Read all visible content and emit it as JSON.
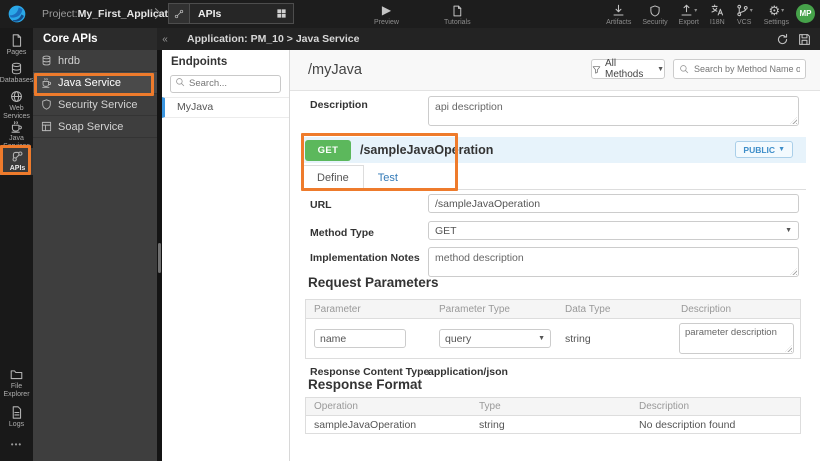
{
  "colors": {
    "annotation_orange": "#ee7b2c",
    "selection_blue": "#3b96e0",
    "get_green": "#5cb85c",
    "link_blue": "#337ab7",
    "avatar_green": "#46a24a"
  },
  "topbar": {
    "project_label": "Project:",
    "project_name": "My_First_Application",
    "apis_tab_label": "APIs",
    "preview_label": "Preview",
    "tutorials_label": "Tutorials",
    "artifacts_label": "Artifacts",
    "security_label": "Security",
    "export_label": "Export",
    "i18n_label": "I18N",
    "vcs_label": "VCS",
    "settings_label": "Settings",
    "avatar_initials": "MP"
  },
  "rail": {
    "items": [
      {
        "label": "Pages"
      },
      {
        "label": "Databases"
      },
      {
        "label": "Web Services"
      },
      {
        "label": "Java Services"
      },
      {
        "label": "APIs"
      },
      {
        "label": "File Explorer"
      },
      {
        "label": "Logs"
      }
    ],
    "more_label": "•••"
  },
  "core_apis": {
    "title": "Core APIs",
    "items": [
      {
        "label": "hrdb"
      },
      {
        "label": "Java Service"
      },
      {
        "label": "Security Service"
      },
      {
        "label": "Soap Service"
      }
    ]
  },
  "subheader": {
    "breadcrumb": "Application: PM_10 > Java Service"
  },
  "endpoints": {
    "title": "Endpoints",
    "search_placeholder": "Search...",
    "items": [
      {
        "label": "MyJava"
      }
    ]
  },
  "main": {
    "title": "/myJava",
    "methods_filter_label": "All Methods",
    "search_placeholder": "Search by Method Name or URL...",
    "description_label": "Description",
    "description_value": "api description",
    "operation": {
      "method": "GET",
      "path": "/sampleJavaOperation",
      "visibility_label": "PUBLIC",
      "tabs": [
        {
          "label": "Define"
        },
        {
          "label": "Test"
        }
      ],
      "url_label": "URL",
      "url_value": "/sampleJavaOperation",
      "method_type_label": "Method Type",
      "method_type_value": "GET",
      "impl_notes_label": "Implementation Notes",
      "impl_notes_value": "method description",
      "request_parameters": {
        "title": "Request Parameters",
        "headers": [
          "Parameter",
          "Parameter Type",
          "Data Type",
          "Description"
        ],
        "row": {
          "parameter": "name",
          "parameter_type": "query",
          "data_type": "string",
          "description": "parameter description"
        }
      },
      "response_content_type_label": "Response Content Type",
      "response_content_type_value": "application/json",
      "response_format": {
        "title": "Response Format",
        "headers": [
          "Operation",
          "Type",
          "Description"
        ],
        "rows": [
          {
            "operation": "sampleJavaOperation",
            "type": "string",
            "description": "No description found"
          }
        ]
      }
    }
  }
}
